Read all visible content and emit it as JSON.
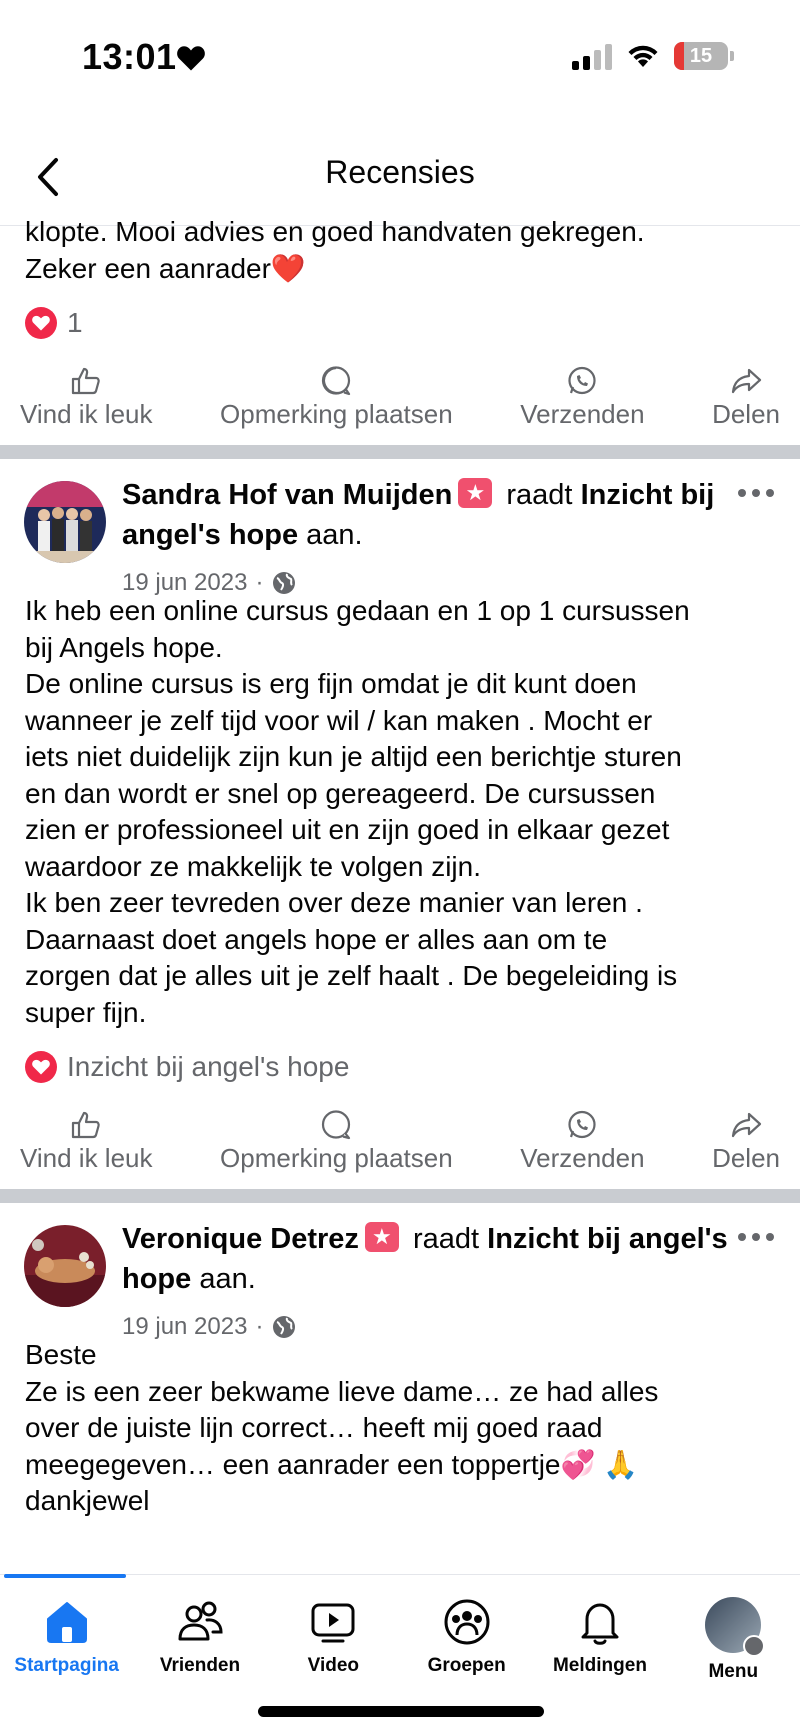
{
  "status_bar": {
    "time": "13:01",
    "battery": "15"
  },
  "header": {
    "title": "Recensies"
  },
  "first_review": {
    "text_lines": [
      "klopte. Mooi advies en goed handvaten gekregen.",
      "Zeker een aanrader❤️"
    ],
    "reaction_count": "1"
  },
  "actions": {
    "like": "Vind ik leuk",
    "comment": "Opmerking plaatsen",
    "send": "Verzenden",
    "share": "Delen"
  },
  "post1": {
    "author": "Sandra Hof van Muijden",
    "verb": "raadt",
    "page": "Inzicht bij angel's hope",
    "suffix": "aan.",
    "date": "19 jun 2023",
    "separator": "·",
    "body_lines": [
      "Ik heb  een online cursus gedaan en 1  op 1 cursussen",
      "bij Angels hope.",
      "De online cursus is erg fijn omdat je dit kunt doen",
      "wanneer je  zelf tijd voor wil / kan maken . Mocht er",
      "iets niet duidelijk zijn kun je altijd een berichtje sturen",
      "en dan wordt er snel op gereageerd. De cursussen",
      "zien er professioneel uit en zijn goed in elkaar gezet",
      "waardoor  ze makkelijk  te volgen zijn.",
      "Ik ben zeer tevreden  over deze manier van leren .",
      "Daarnaast doet angels hope er alles aan om  te",
      "zorgen dat je alles uit je zelf haalt . De begeleiding is",
      "super fijn."
    ],
    "reaction_label": "Inzicht bij angel's hope"
  },
  "post2": {
    "author": "Veronique Detrez",
    "verb": "raadt",
    "page": "Inzicht bij angel's hope",
    "suffix": "aan.",
    "date": "19 jun 2023",
    "separator": "·",
    "body_lines": [
      "Beste",
      "Ze is een zeer bekwame lieve dame… ze had alles",
      "over de juiste lijn correct… heeft mij goed raad",
      "meegegeven… een aanrader een toppertje💞 🙏",
      "dankjewel"
    ]
  },
  "bottom_nav": {
    "items": [
      {
        "label": "Startpagina",
        "icon": "home-icon",
        "active": true
      },
      {
        "label": "Vrienden",
        "icon": "friends-icon"
      },
      {
        "label": "Video",
        "icon": "video-icon"
      },
      {
        "label": "Groepen",
        "icon": "groups-icon"
      },
      {
        "label": "Meldingen",
        "icon": "bell-icon"
      },
      {
        "label": "Menu",
        "icon": "profile-avatar"
      }
    ]
  },
  "colors": {
    "accent": "#1877f2",
    "love": "#f02849",
    "secondary_text": "#65676b",
    "separator": "#c9ccd1"
  }
}
